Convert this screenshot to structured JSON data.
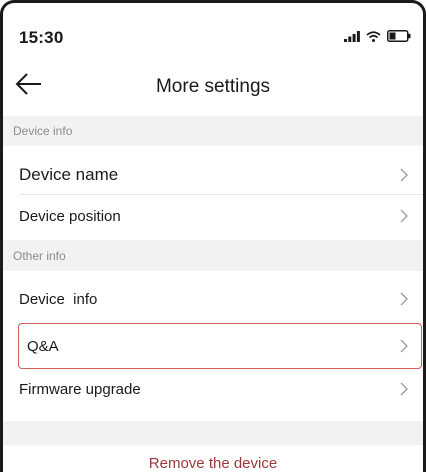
{
  "status_bar": {
    "time": "15:30",
    "icons": [
      "cellular-signal-icon",
      "wifi-icon",
      "battery-icon"
    ]
  },
  "nav": {
    "back_icon": "arrow-left-icon",
    "title": "More settings"
  },
  "sections": [
    {
      "header": "Device info",
      "items": [
        {
          "label": "Device name",
          "icon": "chevron-right-icon"
        },
        {
          "label": "Device position",
          "icon": "chevron-right-icon"
        }
      ]
    },
    {
      "header": "Other info",
      "items": [
        {
          "label": "Device  info",
          "icon": "chevron-right-icon"
        },
        {
          "label": "Q&A",
          "icon": "chevron-right-icon",
          "highlighted": true
        },
        {
          "label": "Firmware upgrade",
          "icon": "chevron-right-icon"
        }
      ]
    }
  ],
  "remove_device": {
    "label": "Remove the device"
  },
  "colors": {
    "section_bg": "#f2f2f2",
    "section_text": "#8c8c8c",
    "highlight_border": "#d85c5c",
    "remove_text": "#9a3b3b"
  }
}
